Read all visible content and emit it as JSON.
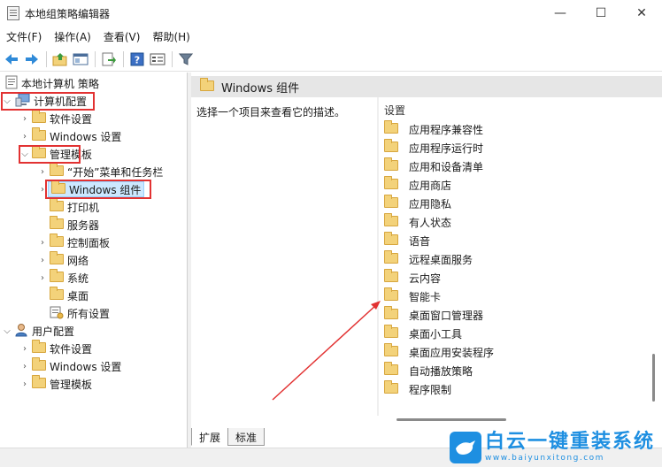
{
  "window": {
    "title": "本地组策略编辑器",
    "controls": {
      "minimize": "—",
      "maximize": "☐",
      "close": "✕"
    }
  },
  "menu": [
    "文件(F)",
    "操作(A)",
    "查看(V)",
    "帮助(H)"
  ],
  "tree": {
    "root": "本地计算机 策略",
    "computer_config": "计算机配置",
    "software_settings": "软件设置",
    "windows_settings": "Windows 设置",
    "admin_templates": "管理模板",
    "start_menu": "“开始”菜单和任务栏",
    "windows_components": "Windows 组件",
    "printers": "打印机",
    "server": "服务器",
    "control_panel": "控制面板",
    "network": "网络",
    "system": "系统",
    "desktop": "桌面",
    "all_settings": "所有设置",
    "user_config": "用户配置",
    "user_software_settings": "软件设置",
    "user_windows_settings": "Windows 设置",
    "user_admin_templates": "管理模板"
  },
  "right": {
    "header": "Windows 组件",
    "description": "选择一个项目来查看它的描述。",
    "list_header": "设置",
    "items": [
      "应用程序兼容性",
      "应用程序运行时",
      "应用和设备清单",
      "应用商店",
      "应用隐私",
      "有人状态",
      "语音",
      "远程桌面服务",
      "云内容",
      "智能卡",
      "桌面窗口管理器",
      "桌面小工具",
      "桌面应用安装程序",
      "自动播放策略",
      "程序限制"
    ]
  },
  "tabs": {
    "extended": "扩展",
    "standard": "标准"
  },
  "watermark": {
    "name": "白云一键重装系统",
    "url": "www.baiyunxitong.com"
  },
  "colors": {
    "annotation": "#e23232",
    "folder": "#f3d27a",
    "selection": "#cce8ff",
    "brand": "#1e8fe1"
  }
}
